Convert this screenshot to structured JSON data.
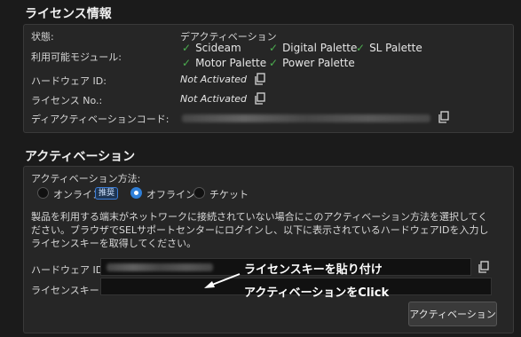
{
  "license": {
    "title": "ライセンス情報",
    "status_label": "状態:",
    "status_value": "デアクティベーション",
    "modules_label": "利用可能モジュール:",
    "modules": [
      "Scideam",
      "Digital Palette",
      "SL Palette",
      "Motor Palette",
      "Power Palette"
    ],
    "hardware_label": "ハードウェア ID:",
    "hardware_value": "Not Activated",
    "license_no_label": "ライセンス No.:",
    "license_no_value": "Not Activated",
    "deactivation_label": "ディアクティベーションコード:"
  },
  "activation": {
    "title": "アクティベーション",
    "method_label": "アクティベーション方法:",
    "options": [
      {
        "label": "オンライン",
        "selected": false
      },
      {
        "label": "オフライン",
        "selected": true
      },
      {
        "label": "チケット",
        "selected": false
      }
    ],
    "recommended_badge": "推奨",
    "description": "製品を利用する端末がネットワークに接続されていない場合にこのアクティベーション方法を選択してください。ブラウザでSELサポートセンターにログインし、以下に表示されているハードウェアIDを入力しライセンスキーを取得してください。",
    "hardware_label": "ハードウェア ID:",
    "license_key_label": "ライセンスキー:",
    "activate_button": "アクティベーション"
  },
  "annotations": {
    "paste_note": "ライセンスキーを貼り付け",
    "click_note": "アクティベーションをClick"
  },
  "colors": {
    "check": "#4caf50",
    "accent": "#2f7fd8",
    "background": "#1b1b1b",
    "panel": "#262626"
  }
}
